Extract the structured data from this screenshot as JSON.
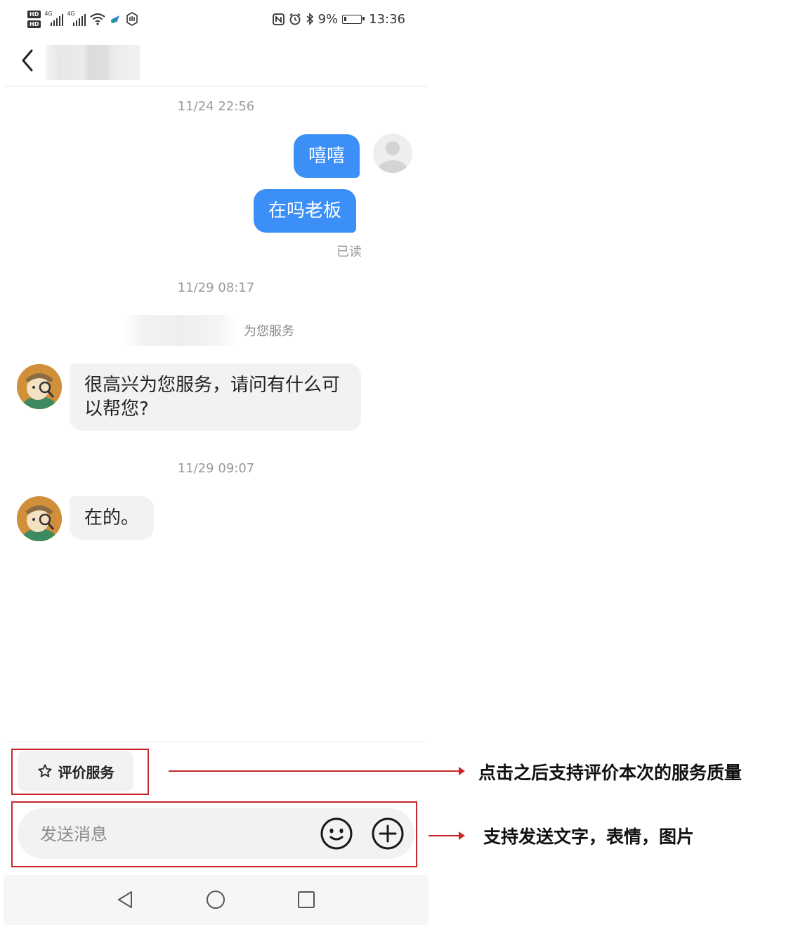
{
  "status_bar": {
    "hd1": "HD",
    "hd2": "HD",
    "net1": "4G",
    "net2": "4G",
    "battery": "9%",
    "time": "13:36"
  },
  "chat": {
    "ts1": "11/24 22:56",
    "msg1": "嘻嘻",
    "msg2": "在吗老板",
    "read": "已读",
    "ts2": "11/29 08:17",
    "serve_label": "为您服务",
    "msg3": "很高兴为您服务，请问有什么可以帮您?",
    "ts3": "11/29 09:07",
    "msg4": "在的。"
  },
  "toolbar": {
    "rate_label": "评价服务",
    "placeholder": "发送消息"
  },
  "annotations": {
    "note1": "点击之后支持评价本次的服务质量",
    "note2": "支持发送文字，表情，图片"
  },
  "colors": {
    "outgoing_bubble": "#3c8ff6",
    "incoming_bubble": "#f2f2f2",
    "annotation_red": "#c8282c"
  },
  "icons": [
    "back-arrow-icon",
    "emoji-icon",
    "plus-icon",
    "star-icon",
    "nav-back-icon",
    "nav-home-icon",
    "nav-recent-icon"
  ]
}
